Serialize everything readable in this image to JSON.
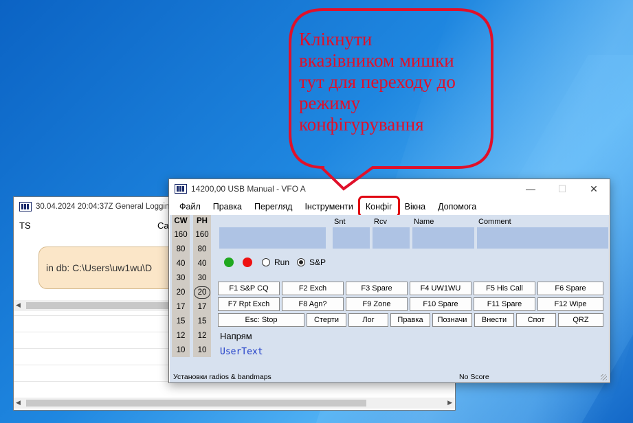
{
  "callout": {
    "text_line1": "Клікнути",
    "text_line2": "вказівником мишки",
    "text_line3": "тут для переходу до",
    "text_line4": "режиму",
    "text_line5": "конфігурування"
  },
  "log_window": {
    "title": "30.04.2024 20:04:37Z  General Logging",
    "col_ts": "TS",
    "col_call": "Ca",
    "info_text": "in db: C:\\Users\\uw1wu\\D"
  },
  "main_window": {
    "title": "14200,00 USB Manual - VFO A",
    "menu": [
      "Файл",
      "Правка",
      "Перегляд",
      "Інструменти",
      "Конфіг",
      "Вікна",
      "Допомога"
    ],
    "bands": {
      "cw_header": "CW",
      "ph_header": "PH",
      "cw": [
        "160",
        "80",
        "40",
        "30",
        "20",
        "17",
        "15",
        "12",
        "10"
      ],
      "ph": [
        "160",
        "80",
        "40",
        "30",
        "20",
        "17",
        "15",
        "12",
        "10"
      ],
      "selected_ph": "20"
    },
    "fields": {
      "snt": "Snt",
      "rcv": "Rcv",
      "name": "Name",
      "comment": "Comment"
    },
    "mode": {
      "run_label": "Run",
      "sp_label": "S&P",
      "selected": "S&P"
    },
    "fkeys_row1": [
      "F1 S&P CQ",
      "F2 Exch",
      "F3 Spare",
      "F4 UW1WU",
      "F5 His Call",
      "F6 Spare"
    ],
    "fkeys_row2": [
      "F7 Rpt Exch",
      "F8 Agn?",
      "F9 Zone",
      "F10 Spare",
      "F11 Spare",
      "F12 Wipe"
    ],
    "buttons_row3": [
      "Esc: Stop",
      "Стерти",
      "Лог",
      "Правка",
      "Позначи",
      "Внести",
      "Спот",
      "QRZ"
    ],
    "direction_label": "Напрям",
    "user_text": "UserText",
    "status_left": "Установки radios & bandmaps",
    "status_right": "No Score"
  },
  "colors": {
    "callout_red": "#e0102a",
    "field_blue": "#aec3e4",
    "client_bg": "#d7e1ef",
    "user_text": "#1e3cc8"
  }
}
